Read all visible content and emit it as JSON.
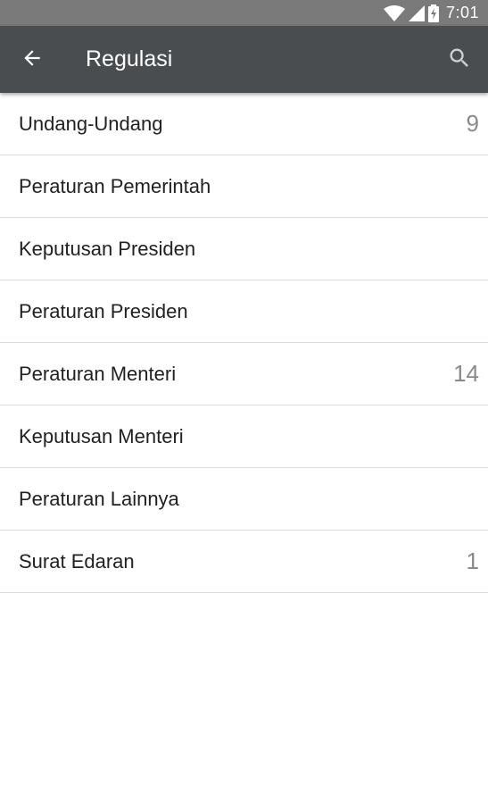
{
  "status_bar": {
    "time": "7:01",
    "icons": [
      "wifi-icon",
      "cell-signal-icon",
      "battery-charging-icon"
    ]
  },
  "app_bar": {
    "title": "Regulasi",
    "back_icon": "arrow-left-icon",
    "search_icon": "search-icon"
  },
  "list": {
    "items": [
      {
        "label": "Undang-Undang",
        "count": "9"
      },
      {
        "label": "Peraturan Pemerintah",
        "count": ""
      },
      {
        "label": "Keputusan Presiden",
        "count": ""
      },
      {
        "label": "Peraturan Presiden",
        "count": ""
      },
      {
        "label": "Peraturan Menteri",
        "count": "14"
      },
      {
        "label": "Keputusan Menteri",
        "count": ""
      },
      {
        "label": "Peraturan Lainnya",
        "count": ""
      },
      {
        "label": "Surat Edaran",
        "count": "1"
      }
    ]
  },
  "colors": {
    "status_bar": "#7a7a7a",
    "app_bar": "#4a4d50",
    "count_text": "#8a8a8a"
  }
}
